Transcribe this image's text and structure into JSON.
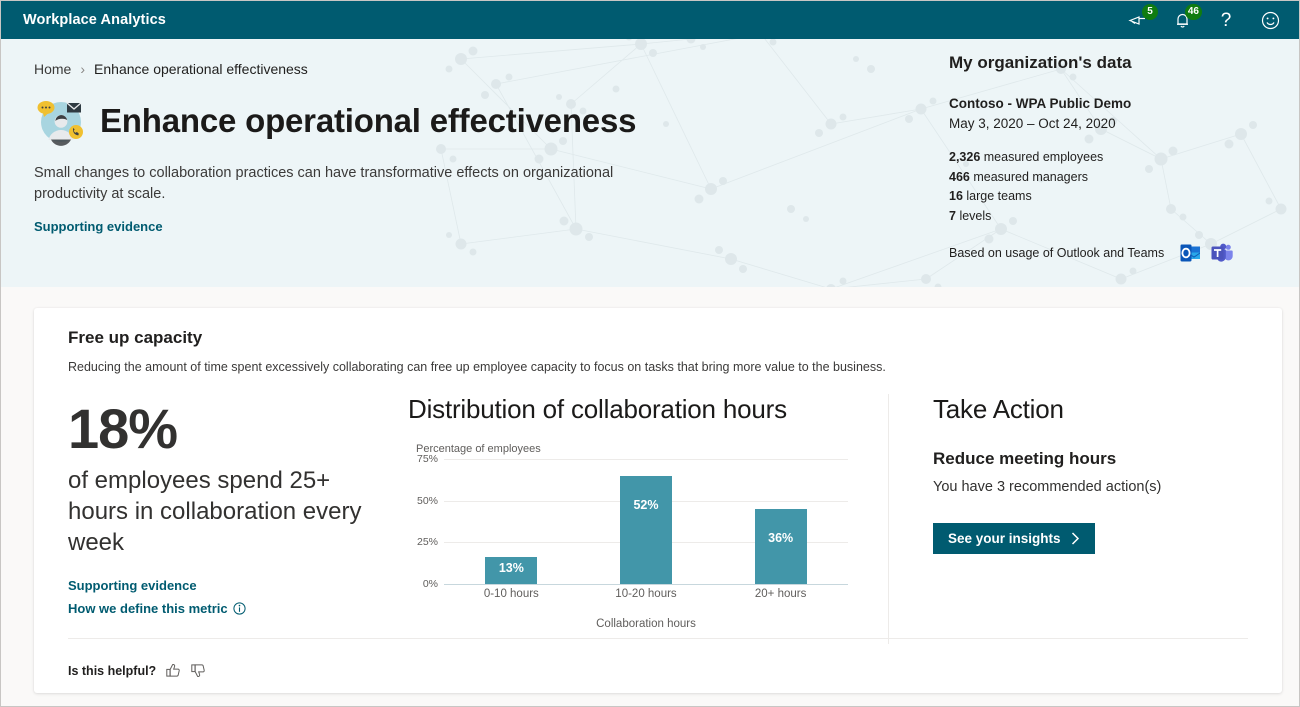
{
  "topbar": {
    "title": "Workplace Analytics",
    "feedback_badge": "5",
    "notifications_badge": "46",
    "help_label": "?"
  },
  "breadcrumb": {
    "home": "Home",
    "separator": "›",
    "current": "Enhance operational effectiveness"
  },
  "hero": {
    "title": "Enhance operational effectiveness",
    "subtitle": "Small changes to collaboration practices can have transformative effects on organizational productivity at scale.",
    "link": "Supporting evidence"
  },
  "org": {
    "heading": "My organization's data",
    "tenant": "Contoso - WPA Public Demo",
    "date_range": "May 3, 2020 – Oct 24, 2020",
    "stats": [
      {
        "value": "2,326",
        "label": "measured employees"
      },
      {
        "value": "466",
        "label": "measured managers"
      },
      {
        "value": "16",
        "label": "large teams"
      },
      {
        "value": "7",
        "label": "levels"
      }
    ],
    "based_on": "Based on usage of Outlook and Teams"
  },
  "card": {
    "title": "Free up capacity",
    "description": "Reducing the amount of time spent excessively collaborating can free up employee capacity to focus on tasks that bring more value to the business.",
    "stat": {
      "big": "18%",
      "text": "of employees spend 25+ hours in collaboration every week",
      "link_evidence": "Supporting evidence",
      "link_metric": "How we define this metric"
    },
    "action": {
      "title": "Take Action",
      "subtitle": "Reduce meeting hours",
      "description": "You have 3 recommended action(s)",
      "button": "See your insights",
      "button_chevron": "›"
    },
    "footer": {
      "question": "Is this helpful?"
    }
  },
  "chart_data": {
    "type": "bar",
    "title": "Distribution of collaboration hours",
    "xlabel": "Collaboration hours",
    "ylabel": "Percentage of employees",
    "categories": [
      "0-10 hours",
      "10-20 hours",
      "20+ hours"
    ],
    "values": [
      13,
      52,
      36
    ],
    "value_labels": [
      "13%",
      "52%",
      "36%"
    ],
    "yticks": [
      0,
      25,
      50,
      75
    ],
    "ytick_labels": [
      "0%",
      "25%",
      "50%",
      "75%"
    ],
    "ylim": [
      0,
      80
    ],
    "grid": true,
    "legend": false,
    "bar_color": "#4296a9"
  },
  "colors": {
    "brand": "#005b70",
    "hero_bg": "#edf5f7",
    "page_bg": "#faf9f8",
    "badge_green": "#107c10",
    "bar_teal": "#4296a9"
  }
}
